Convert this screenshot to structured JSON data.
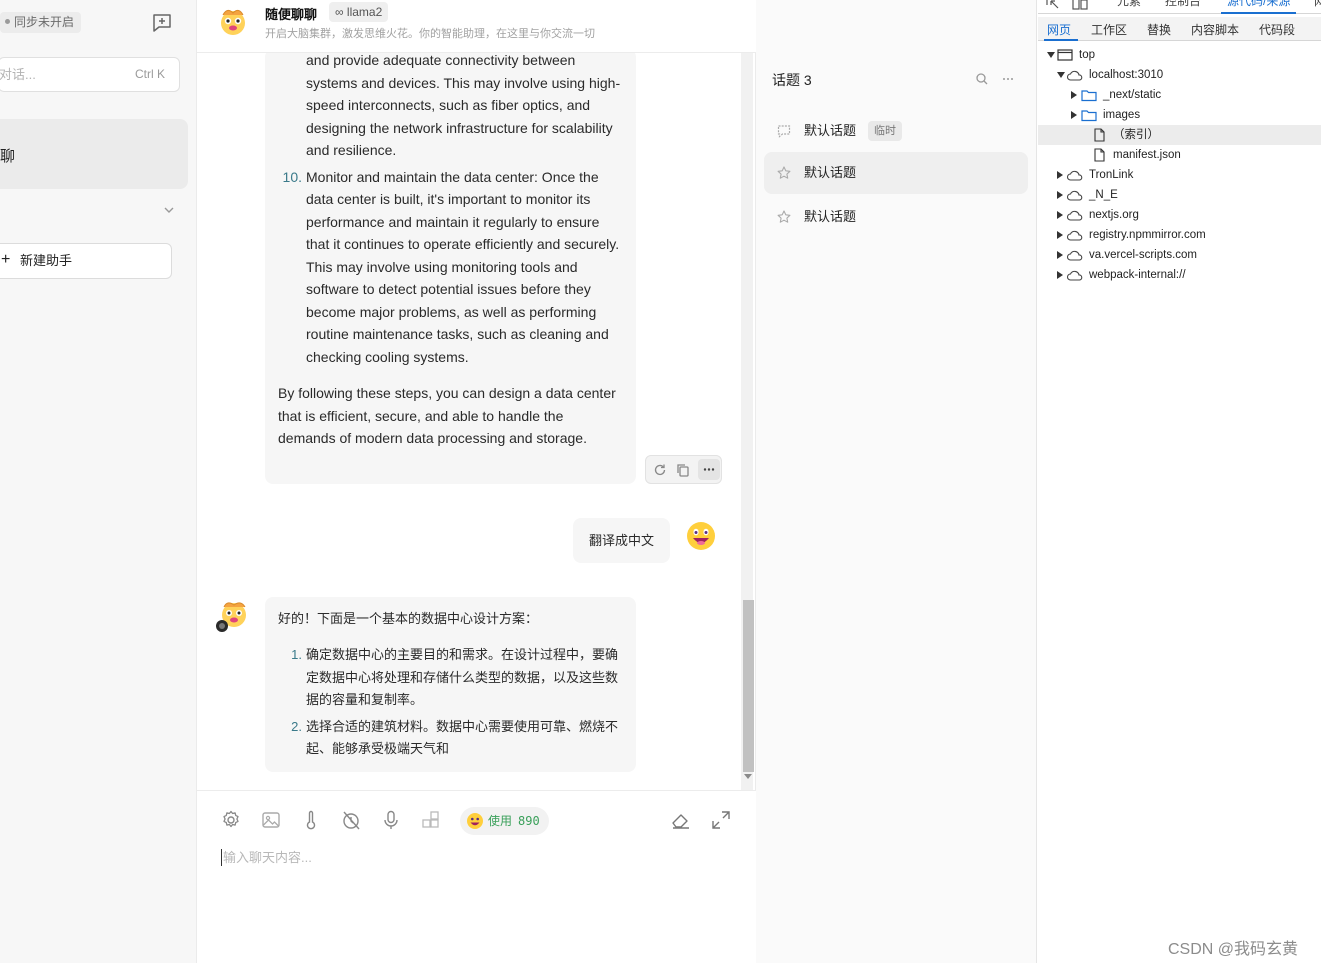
{
  "sidebar": {
    "sync_status": "同步未开启",
    "search_placeholder": "对话...",
    "search_shortcut": "Ctrl K",
    "active_session_label": "聊",
    "new_agent_label": "新建助手"
  },
  "header": {
    "title": "随便聊聊",
    "model": "llama2",
    "description": "开启大脑集群，激发思维火花。你的智能助理，在这里与你交流一切"
  },
  "messages": {
    "assistant_1": {
      "item9_continued": "and provide adequate connectivity between systems and devices. This may involve using high-speed interconnects, such as fiber optics, and designing the network infrastructure for scalability and resilience.",
      "item10_number": "10.",
      "item10_text": "Monitor and maintain the data center: Once the data center is built, it's important to monitor its performance and maintain it regularly to ensure that it continues to operate efficiently and securely. This may involve using monitoring tools and software to detect potential issues before they become major problems, as well as performing routine maintenance tasks, such as cleaning and checking cooling systems.",
      "conclusion": "By following these steps, you can design a data center that is efficient, secure, and able to handle the demands of modern data processing and storage."
    },
    "user_1": "翻译成中文",
    "assistant_2": {
      "intro": "好的！下面是一个基本的数据中心设计方案：",
      "items": [
        {
          "num": "1.",
          "text": "确定数据中心的主要目的和需求。在设计过程中，要确定数据中心将处理和存储什么类型的数据，以及这些数据的容量和复制率。"
        },
        {
          "num": "2.",
          "text": "选择合适的建筑材料。数据中心需要使用可靠、燃烧不起、能够承受极端天气和"
        }
      ]
    }
  },
  "input": {
    "usage_label": "使用",
    "usage_count": "890",
    "placeholder": "输入聊天内容..."
  },
  "topics": {
    "header": "话题 3",
    "items": [
      {
        "label": "默认话题",
        "tag": "临时",
        "icon": "chat-bubble-icon"
      },
      {
        "label": "默认话题",
        "icon": "star-icon"
      },
      {
        "label": "默认话题",
        "icon": "star-icon"
      }
    ]
  },
  "devtools": {
    "top_tabs": [
      "元素",
      "控制台",
      "源代码/来源"
    ],
    "sub_tabs": [
      "网页",
      "工作区",
      "替换",
      "内容脚本",
      "代码段"
    ],
    "tree": [
      {
        "label": "top",
        "level": 0,
        "type": "frame",
        "open": true
      },
      {
        "label": "localhost:3010",
        "level": 1,
        "type": "cloud",
        "open": true
      },
      {
        "label": "_next/static",
        "level": 2,
        "type": "folder",
        "open": false
      },
      {
        "label": "images",
        "level": 2,
        "type": "folder",
        "open": false
      },
      {
        "label": "（索引）",
        "level": 3,
        "type": "file",
        "selected": true
      },
      {
        "label": "manifest.json",
        "level": 3,
        "type": "file"
      },
      {
        "label": "TronLink",
        "level": 1,
        "type": "cloud",
        "open": false
      },
      {
        "label": "_N_E",
        "level": 1,
        "type": "cloud",
        "open": false
      },
      {
        "label": "nextjs.org",
        "level": 1,
        "type": "cloud",
        "open": false
      },
      {
        "label": "registry.npmmirror.com",
        "level": 1,
        "type": "cloud",
        "open": false
      },
      {
        "label": "va.vercel-scripts.com",
        "level": 1,
        "type": "cloud",
        "open": false
      },
      {
        "label": "webpack-internal://",
        "level": 1,
        "type": "cloud",
        "open": false
      }
    ]
  },
  "watermark": "CSDN @我码玄黄",
  "colors": {
    "accent_blue": "#1a6fd0",
    "usage_green": "#3aa05a",
    "list_number": "#3a7a8a"
  }
}
